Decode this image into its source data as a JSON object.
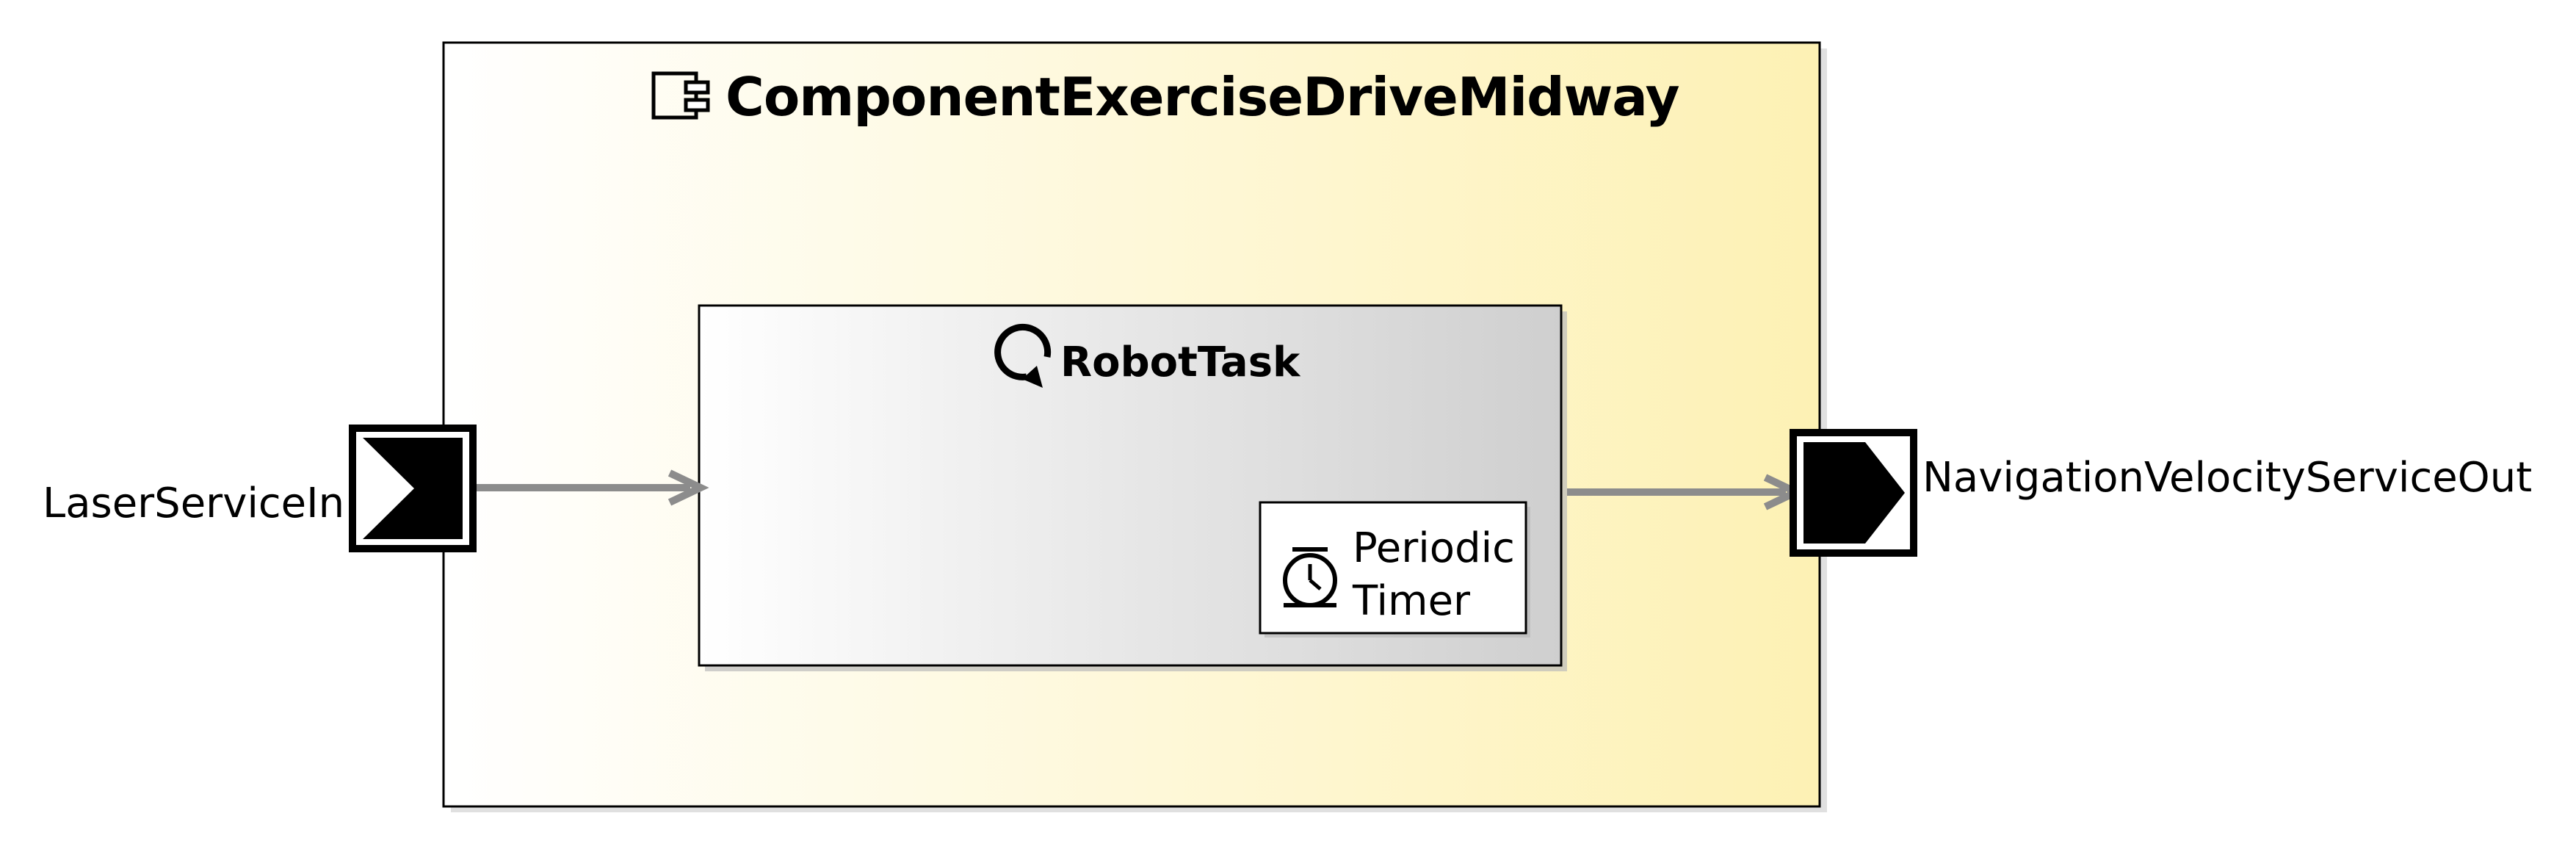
{
  "component": {
    "name": "ComponentExerciseDriveMidway",
    "icon": "component-icon",
    "gradient_start": "#ffffff",
    "gradient_end": "#fdf1b4"
  },
  "task": {
    "name": "RobotTask",
    "icon": "refresh-loop-icon",
    "gradient_start": "#ffffff",
    "gradient_end": "#cfcfcf"
  },
  "timer": {
    "line1": "Periodic",
    "line2": "Timer",
    "icon": "stopwatch-icon"
  },
  "ports": {
    "input_label": "LaserServiceIn",
    "output_label": "NavigationVelocityServiceOut",
    "input_icon": "input-port-icon",
    "output_icon": "output-port-icon"
  },
  "connector_color": "#8c8c8c"
}
